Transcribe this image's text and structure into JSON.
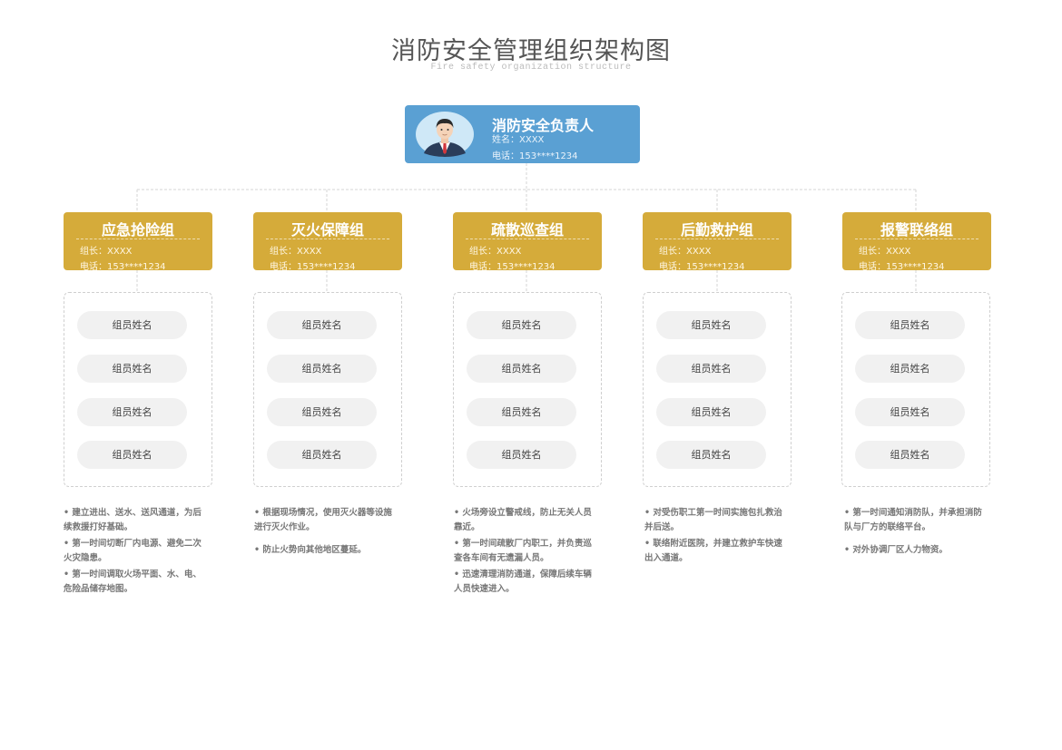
{
  "header": {
    "title": "消防安全管理组织架构图",
    "subtitle": "Fire safety organization structure"
  },
  "head": {
    "role": "消防安全负责人",
    "name": "姓名：XXXX",
    "phone": "电话：153****1234",
    "avatar_icon": "person-avatar-icon"
  },
  "colors": {
    "head": "#5aa0d3",
    "group": "#d5ab3a",
    "pill": "#f1f1f1",
    "connector": "#d6d6d6"
  },
  "groups": [
    {
      "title": "应急抢险组",
      "leader": "组长：XXXX",
      "phone": "电话：153****1234",
      "members": [
        "组员姓名",
        "组员姓名",
        "组员姓名",
        "组员姓名"
      ],
      "duties": [
        "• 建立进出、送水、送风通道，为后续救援打好基础。",
        "• 第一时间切断厂内电源、避免二次火灾隐患。",
        "• 第一时间调取火场平面、水、电、危险品储存地图。"
      ]
    },
    {
      "title": "灭火保障组",
      "leader": "组长：XXXX",
      "phone": "电话：153****1234",
      "members": [
        "组员姓名",
        "组员姓名",
        "组员姓名",
        "组员姓名"
      ],
      "duties": [
        "• 根据现场情况，使用灭火器等设施进行灭火作业。",
        "• 防止火势向其他地区蔓延。"
      ]
    },
    {
      "title": "疏散巡查组",
      "leader": "组长：XXXX",
      "phone": "电话：153****1234",
      "members": [
        "组员姓名",
        "组员姓名",
        "组员姓名",
        "组员姓名"
      ],
      "duties": [
        "• 火场旁设立警戒线，防止无关人员靠近。",
        "• 第一时间疏散厂内职工，并负责巡查各车间有无遗漏人员。",
        "• 迅速清理消防通道，保障后续车辆人员快速进入。"
      ]
    },
    {
      "title": "后勤救护组",
      "leader": "组长：XXXX",
      "phone": "电话：153****1234",
      "members": [
        "组员姓名",
        "组员姓名",
        "组员姓名",
        "组员姓名"
      ],
      "duties": [
        "• 对受伤职工第一时间实施包扎救治并后送。",
        "• 联络附近医院，并建立救护车快速出入通道。"
      ]
    },
    {
      "title": "报警联络组",
      "leader": "组长：XXXX",
      "phone": "电话：153****1234",
      "members": [
        "组员姓名",
        "组员姓名",
        "组员姓名",
        "组员姓名"
      ],
      "duties": [
        "• 第一时间通知消防队，并承担消防队与厂方的联络平台。",
        "• 对外协调厂区人力物资。"
      ]
    }
  ]
}
